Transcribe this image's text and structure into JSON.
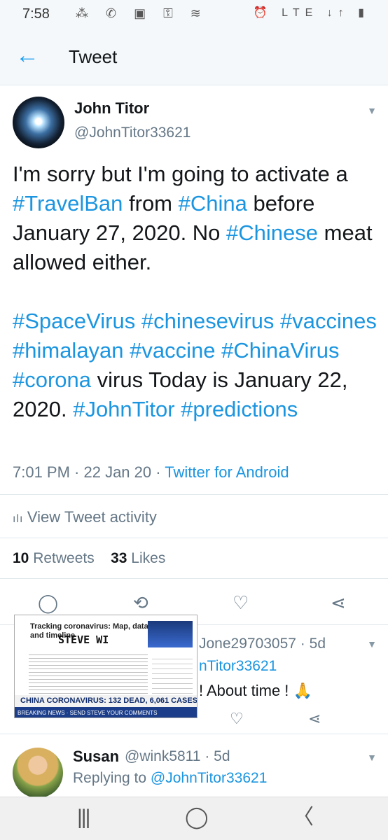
{
  "status": {
    "time": "7:58",
    "icons": "⁂ ✆ ▣ ⚿ ≋",
    "right": "⏰ LTE ↓↑ ▮"
  },
  "header": {
    "back_glyph": "←",
    "title": "Tweet"
  },
  "tweet": {
    "author_name": "John Titor",
    "author_handle": "@JohnTitor33621",
    "segments": [
      {
        "text": "I'm sorry but I'm going to activate a ",
        "tag": false
      },
      {
        "text": "#TravelBan",
        "tag": true
      },
      {
        "text": " from ",
        "tag": false
      },
      {
        "text": "#China",
        "tag": true
      },
      {
        "text": " before January 27, 2020. No ",
        "tag": false
      },
      {
        "text": "#Chinese",
        "tag": true
      },
      {
        "text": " meat allowed either.\n\n ",
        "tag": false
      },
      {
        "text": "#SpaceVirus",
        "tag": true
      },
      {
        "text": " ",
        "tag": false
      },
      {
        "text": "#chinesevirus",
        "tag": true
      },
      {
        "text": " ",
        "tag": false
      },
      {
        "text": "#vaccines",
        "tag": true
      },
      {
        "text": " ",
        "tag": false
      },
      {
        "text": "#himalayan",
        "tag": true
      },
      {
        "text": " ",
        "tag": false
      },
      {
        "text": "#vaccine",
        "tag": true
      },
      {
        "text": " ",
        "tag": false
      },
      {
        "text": "#ChinaVirus",
        "tag": true
      },
      {
        "text": " ",
        "tag": false
      },
      {
        "text": "#corona",
        "tag": true
      },
      {
        "text": " virus Today is January 22, 2020. ",
        "tag": false
      },
      {
        "text": "#JohnTitor",
        "tag": true
      },
      {
        "text": " ",
        "tag": false
      },
      {
        "text": "#predictions",
        "tag": true
      }
    ],
    "time": "7:01 PM · 22 Jan 20 · ",
    "source": "Twitter for Android",
    "activity_label": "View Tweet activity",
    "retweets_count": "10",
    "retweets_label": "Retweets",
    "likes_count": "33",
    "likes_label": "Likes"
  },
  "actions": {
    "reply": "◯",
    "retweet": "⟲",
    "like": "♡",
    "share": "⋖"
  },
  "reply1": {
    "handle_partial": "Jone29703057 · 5d",
    "replying_partial": "nTitor33621",
    "text_partial": "! About time ! 🙏"
  },
  "overlay": {
    "title": "Tracking coronavirus: Map, data and timeline",
    "big_text": "STEVE WI",
    "banner": "CHINA CORONAVIRUS: 132 DEAD, 6,061 CASES",
    "ticker": "BREAKING NEWS · SEND STEVE YOUR COMMENTS"
  },
  "reply2": {
    "name": "Susan",
    "handle": "@wink5811 · 5d",
    "replying_prefix": "Replying to ",
    "replying_to": "@JohnTitor33621"
  },
  "navbar": {
    "recents": "|||",
    "home": "◯",
    "back": "〈"
  }
}
